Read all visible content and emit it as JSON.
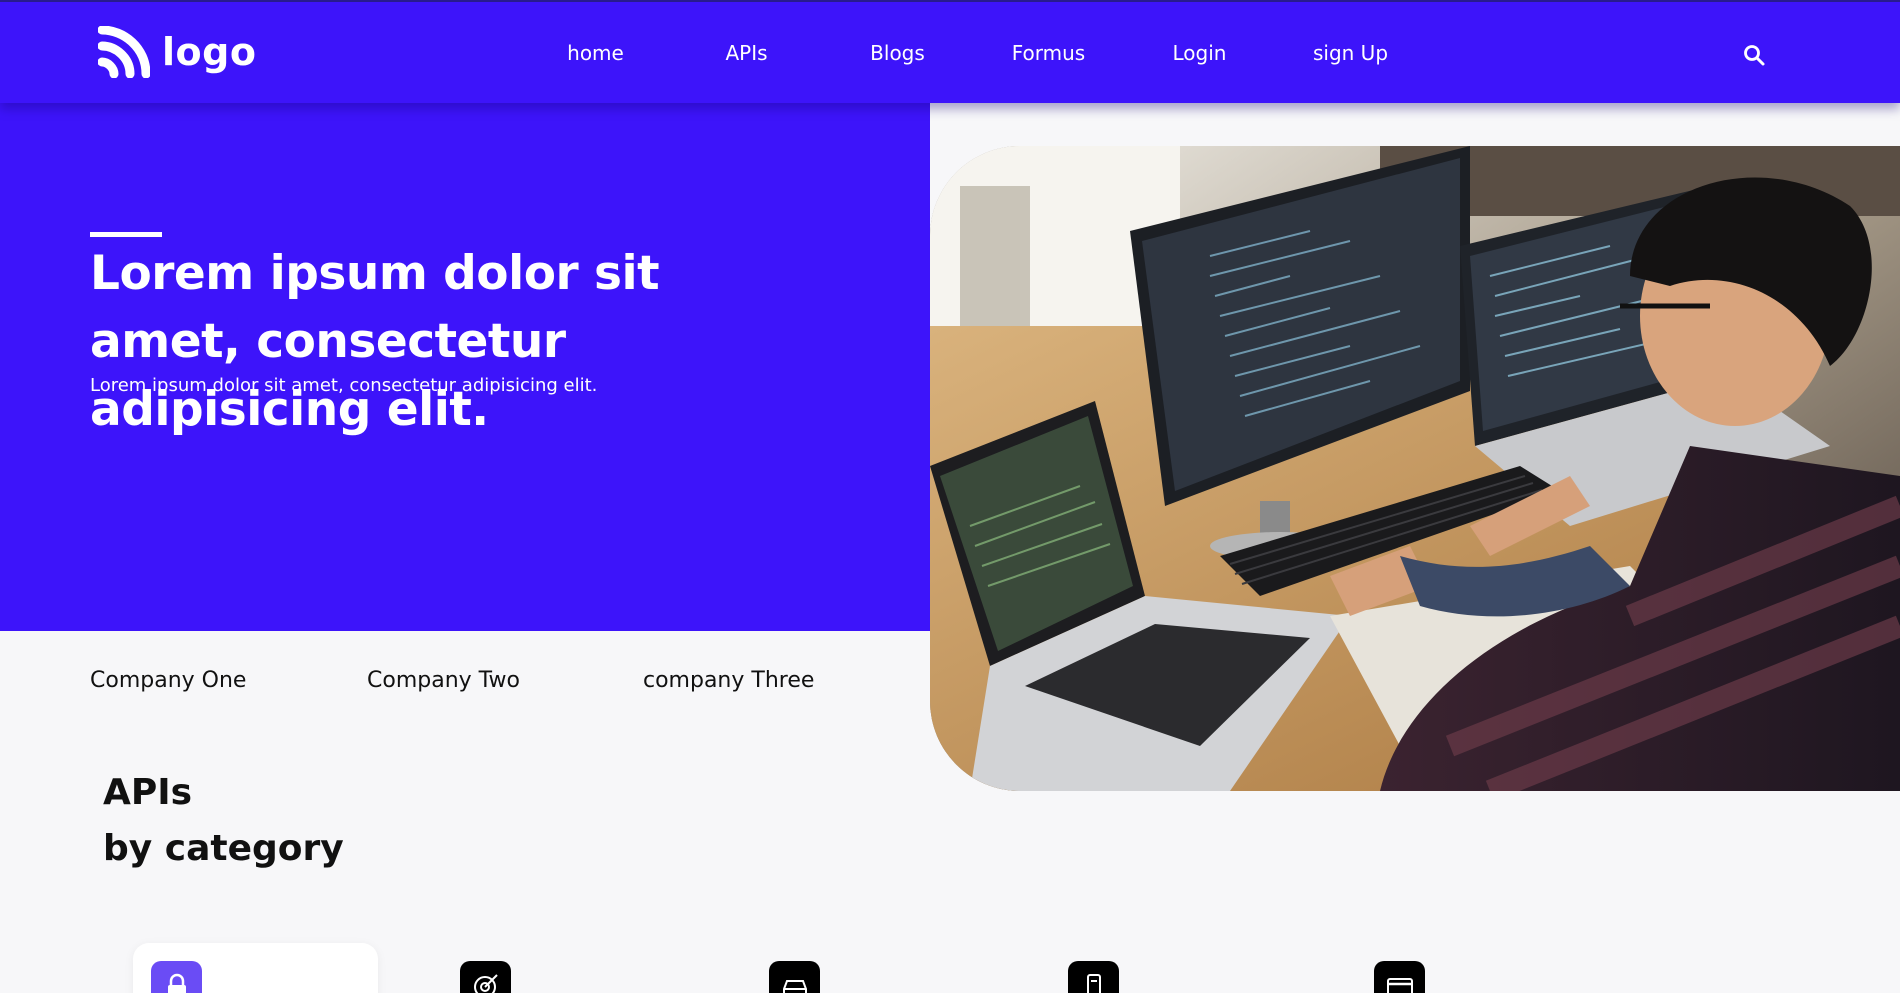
{
  "brand": {
    "logo_text": "logo",
    "primary_color": "#3d14fa"
  },
  "nav": {
    "items": [
      {
        "label": "home"
      },
      {
        "label": "APIs"
      },
      {
        "label": "Blogs"
      },
      {
        "label": "Formus"
      },
      {
        "label": "Login"
      },
      {
        "label": "sign Up"
      }
    ],
    "search_icon": "search-icon"
  },
  "hero": {
    "title": "Lorem ipsum dolor sit amet, consectetur adipisicing elit.",
    "subtitle": "Lorem ipsum dolor sit amet, consectetur adipisicing elit.",
    "image": "developer-at-desk-photo"
  },
  "companies": [
    "Company One",
    "Company Two",
    "company Three"
  ],
  "apis_section": {
    "title_line1": "APIs",
    "title_line2": "by category"
  },
  "categories": [
    {
      "icon": "lock-icon",
      "active": true
    },
    {
      "icon": "target-icon",
      "active": false
    },
    {
      "icon": "car-icon",
      "active": false
    },
    {
      "icon": "device-icon",
      "active": false
    },
    {
      "icon": "card-icon",
      "active": false
    }
  ]
}
